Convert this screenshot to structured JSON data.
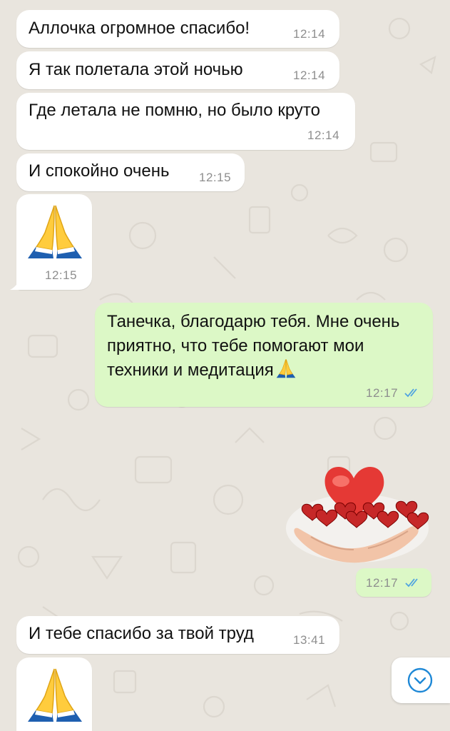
{
  "chat": {
    "messages": [
      {
        "direction": "incoming",
        "text": "Аллочка огромное спасибо!",
        "time": "12:14"
      },
      {
        "direction": "incoming",
        "text": "Я так полетала этой ночью",
        "time": "12:14"
      },
      {
        "direction": "incoming",
        "text": "Где летала не помню, но было круто",
        "time": "12:14"
      },
      {
        "direction": "incoming",
        "text": "И спокойно очень",
        "time": "12:15"
      },
      {
        "direction": "incoming",
        "type": "emoji",
        "emoji": "praying-hands",
        "time": "12:15"
      },
      {
        "direction": "outgoing",
        "text": "Танечка, благодарю тебя. Мне очень приятно, что тебе помогают мои техники и медитация",
        "time": "12:17",
        "status": "read"
      },
      {
        "direction": "outgoing",
        "type": "sticker",
        "sticker": "hearts-in-hands",
        "time": "12:17",
        "status": "read"
      },
      {
        "direction": "incoming",
        "text": "И тебе спасибо за твой труд",
        "time": "13:41"
      },
      {
        "direction": "incoming",
        "type": "emoji",
        "emoji": "praying-hands"
      }
    ]
  },
  "colors": {
    "background": "#e9e5de",
    "incoming_bubble": "#ffffff",
    "outgoing_bubble": "#dcf8c6",
    "read_checks": "#4fa3e0",
    "scroll_button_icon": "#1e88d6"
  },
  "controls": {
    "scroll_down_icon": "chevron-down-circle-icon"
  }
}
